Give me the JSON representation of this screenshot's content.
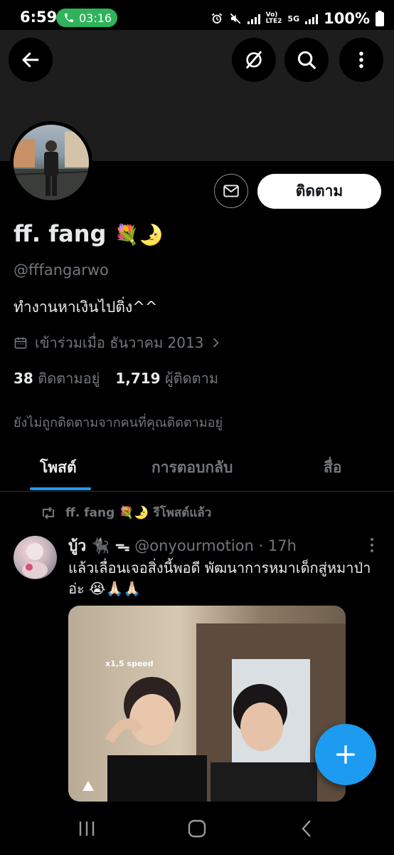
{
  "status_bar": {
    "time": "6:59",
    "call_timer": "03:16",
    "network_label_top": "Vo)",
    "network_label_bottom": "LTE2",
    "network_5g": "5G",
    "battery": "100%"
  },
  "header": {
    "back_icon": "arrow-left-icon",
    "translate_icon": "hidden-eye-slash-icon",
    "search_icon": "search-icon",
    "more_icon": "vertical-dots-icon"
  },
  "profile": {
    "display_name": "ff. fang",
    "name_emojis": "💐🌛",
    "handle": "@fffangarwo",
    "bio": "ทำงานหาเงินไปติ่ง^^",
    "joined": "เข้าร่วมเมื่อ ธันวาคม 2013",
    "following_count": "38",
    "following_label": "ติดตามอยู่",
    "followers_count": "1,719",
    "followers_label": "ผู้ติดตาม",
    "not_followed_note": "ยังไม่ถูกติดตามจากคนที่คุณติดตามอยู่",
    "follow_button": "ติดตาม"
  },
  "tabs": [
    {
      "label": "โพสต์",
      "active": true
    },
    {
      "label": "การตอบกลับ",
      "active": false
    },
    {
      "label": "สื่อ",
      "active": false
    }
  ],
  "post": {
    "repost_by": "ff. fang 💐🌛 รีโพสต์แล้ว",
    "author_name": "บู้ว 🐈‍⬛ ᯓ",
    "author_handle": "@onyourmotion",
    "time": "· 17h",
    "text": "แล้วเลื่อนเจอสิ่งนี้พอดี พัฒนาการหมาเด็กสู่หมาป่าอ่ะ 😭🙏🏻🙏🏻",
    "media_caption": "x1,5 speed"
  },
  "colors": {
    "accent": "#1d9bf0",
    "secondary_text": "#71767b",
    "primary_text": "#e7e9ea",
    "call_pill": "#2fb35a",
    "banner": "#1d1d1d"
  }
}
